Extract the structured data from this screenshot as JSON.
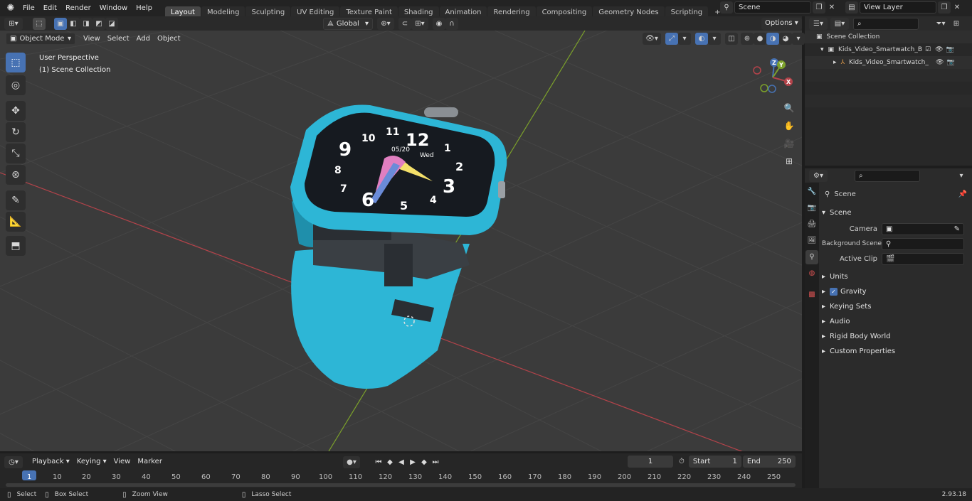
{
  "app": {
    "menu": [
      "File",
      "Edit",
      "Render",
      "Window",
      "Help"
    ],
    "workspaces": [
      "Layout",
      "Modeling",
      "Sculpting",
      "UV Editing",
      "Texture Paint",
      "Shading",
      "Animation",
      "Rendering",
      "Compositing",
      "Geometry Nodes",
      "Scripting"
    ],
    "active_workspace": "Layout",
    "scene_name": "Scene",
    "view_layer": "View Layer",
    "version": "2.93.18"
  },
  "viewport": {
    "transform_orientation": "Global",
    "options_label": "Options",
    "mode": "Object Mode",
    "menus": [
      "View",
      "Select",
      "Add",
      "Object"
    ],
    "overlay_title": "User Perspective",
    "overlay_subtitle": "(1) Scene Collection",
    "gizmo_axes": [
      "Z",
      "Y",
      "X"
    ]
  },
  "outliner": {
    "search_placeholder": "",
    "root": "Scene Collection",
    "items": [
      {
        "label": "Kids_Video_Smartwatch_Blue"
      },
      {
        "label": "Kids_Video_Smartwatch_"
      }
    ]
  },
  "properties": {
    "breadcrumb": "Scene",
    "panel_title": "Scene",
    "fields": [
      {
        "label": "Camera",
        "value": ""
      },
      {
        "label": "Background Scene",
        "value": ""
      },
      {
        "label": "Active Clip",
        "value": ""
      }
    ],
    "sections": [
      "Units",
      "Gravity",
      "Keying Sets",
      "Audio",
      "Rigid Body World",
      "Custom Properties"
    ],
    "gravity_checked": true
  },
  "timeline": {
    "menus": [
      "Playback",
      "Keying",
      "View",
      "Marker"
    ],
    "current_frame": "1",
    "start_label": "Start",
    "start_value": "1",
    "end_label": "End",
    "end_value": "250",
    "ticks": [
      "1",
      "10",
      "20",
      "30",
      "40",
      "50",
      "60",
      "70",
      "80",
      "90",
      "100",
      "110",
      "120",
      "130",
      "140",
      "150",
      "160",
      "170",
      "180",
      "190",
      "200",
      "210",
      "220",
      "230",
      "240",
      "250"
    ]
  },
  "statusbar": {
    "select": "Select",
    "box_select": "Box Select",
    "zoom_view": "Zoom View",
    "lasso_select": "Lasso Select"
  },
  "watch": {
    "clock_numbers": [
      "12",
      "1",
      "2",
      "3",
      "4",
      "5",
      "6",
      "7",
      "8",
      "9",
      "10",
      "11"
    ],
    "date": "05/20",
    "day": "Wed"
  },
  "colors": {
    "accent": "#4772b3",
    "watch_body": "#2db6d6",
    "x_axis": "#b3434a",
    "y_axis": "#7ca12b"
  }
}
